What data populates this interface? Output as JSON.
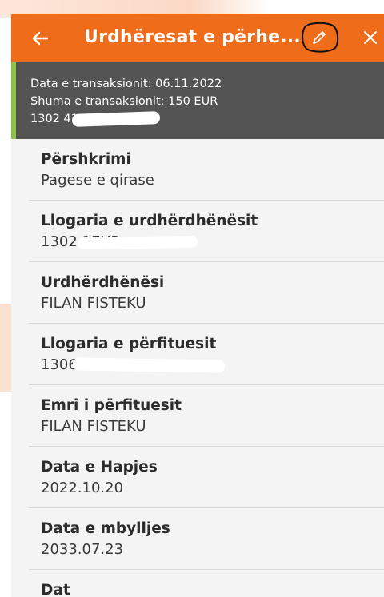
{
  "header": {
    "title": "Urdhëresat e përhe...",
    "back_icon": "arrow-left-icon",
    "edit_icon": "pencil-icon",
    "close_icon": "close-icon"
  },
  "summary": {
    "date_line": "Data e transaksionit: 06.11.2022",
    "amount_line": "Shuma e transaksionit: 150 EUR",
    "account_line": "1302   41EUR"
  },
  "fields": [
    {
      "label": "Përshkrimi",
      "value": "Pagese e qirase"
    },
    {
      "label": "Llogaria e urdhërdhënësit",
      "value": "1302   1EUR"
    },
    {
      "label": "Urdhërdhënësi",
      "value": "FILAN FISTEKU"
    },
    {
      "label": "Llogaria e përfituesit",
      "value": "1306   4"
    },
    {
      "label": "Emri i përfituesit",
      "value": "FILAN FISTEKU"
    },
    {
      "label": "Data e Hapjes",
      "value": "2022.10.20"
    },
    {
      "label": "Data e mbylljes",
      "value": "2033.07.23"
    },
    {
      "label": "Dat",
      "value": ""
    }
  ],
  "colors": {
    "appbar": "#ef6c1a",
    "summary_bg": "#545454",
    "accent_stripe": "#8bc34a",
    "panel_bg": "#f4f4f4"
  }
}
